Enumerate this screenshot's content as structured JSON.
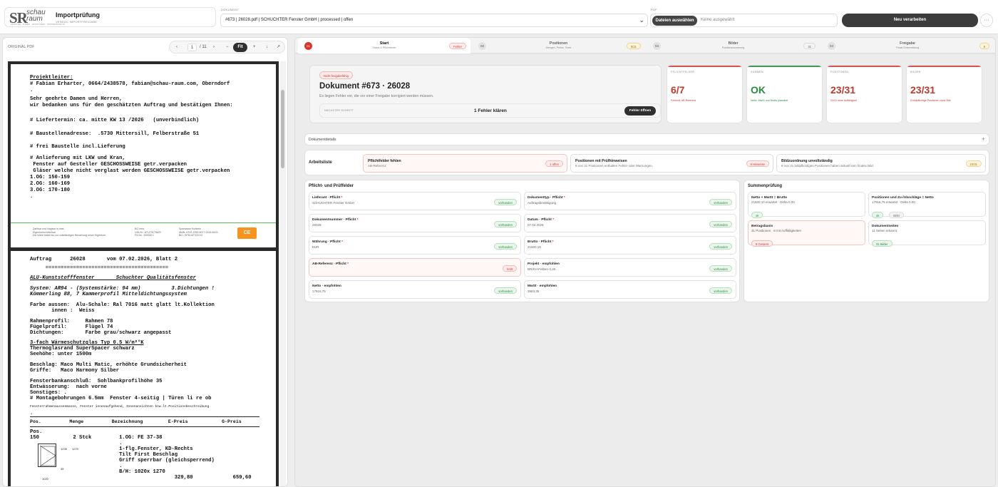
{
  "header": {
    "logo_sr": "SR",
    "logo_schau": "schau",
    "logo_raum": "raum",
    "logo_tag": "FENSTER · TÜREN · HAUSTÜREN · SONNENSCHUTZ",
    "app_title": "Importprüfung",
    "app_subtitle": "VENDOC IMPORTFREIGABE",
    "doc_label": "DOKUMENT",
    "doc_value": "#673 | 26028.pdf | SCHUCHTER Fenster GmbH | processed | offen",
    "pdf_label": "PDF",
    "file_button": "Dateien auswählen",
    "file_none": "Keine ausgewählt",
    "reprocess": "Neu verarbeiten",
    "more": "···"
  },
  "viewer": {
    "title": "ORIGINAL PDF",
    "prev": "‹",
    "page": "1",
    "total": "/ 11",
    "next": "›",
    "zoom_out": "−",
    "fit": "Fit",
    "zoom_in": "+",
    "download": "↓",
    "open": "↗",
    "page1": [
      "Projektleiter:",
      "# Fabian Erharter, 0664/2438578, fabian@schau-raum.com, Oberndorf",
      ".",
      "Sehr geehrte Damen und Herren,",
      "wir bedanken uns für den geschätzten Auftrag und bestätigen Ihnen:",
      "# Liefertermin: ca. mitte KW 13 /2026   (unverbindlich)",
      "# Baustellenadresse:  .5730 Mittersill, Felberstraße 51",
      "# frei Baustelle incl.Lieferung",
      "# Anlieferung mit LKW und Kran,",
      " Fenster auf Gesteller GESCHOSSWEISE getr.verpacken",
      " Gläser welche nicht verglast werden GESCHOSSWEISE getr.verpacken",
      "1.OG: 150-159",
      "2.OG: 160-169",
      "3.OG: 170-180",
      "."
    ],
    "footer1": [
      "Zahlbar und klagbar in Imst",
      "Eigentumsvorbehalt",
      "Die Ware bleibt bis zur vollständigen Bezahlung unser Eigentum."
    ],
    "footer2": [
      "BG Imst",
      "UID-Nr.: ATU79175629",
      "FN-Nr.: 599940 t"
    ],
    "footer3": [
      "Sparkasse Kufstein",
      "IBAN: AT43 2050 6077 0016 8425",
      "BIC: SPKUAT22XXX"
    ],
    "ce": "CE",
    "page2": [
      "Auftrag      26028       vom 07.02.2026, Blatt 2",
      "     ========================================",
      "ALU-Kunststofffenster       Schuchter Qualitätsfenster",
      "System: AR94 - (Systemstärke: 94 mm)          3.Dichtungen !",
      "Kömmerling 88, 7 Kammerprofil Mitteldichtungssystem",
      "Farbe aussen:  Alu-Schale: Ral 7016 matt glatt lt.Kollektion",
      "       innen :  Weiss",
      "Rahmenprofil:     Rahmen 78",
      "Fügelprofil:      Flügel 74",
      "Dichtungen:       Farbe grau/schwarz angepasst",
      "3-fach Wärmeschutzglas Typ 0.5 W/m²°K",
      "Thermoglasrand SuperSpacer schwarz",
      "Seehöhe: unter 1500m",
      "Beschlag: Maco Multi Matic, erhöhte Grundsicherheit",
      "Griffe:   Maco Harmony Silber",
      "Fensterbankanschluß:  Sohlbankprofilhöhe 35",
      "Entwässerung:  nach vorne",
      "Sonstiges: .",
      "# Montagebohrungen 6.5mm  Fenster 4-seitig | Türen li re ob",
      "Fensterrahmenaussenmasse, Fenster innenaufgehend, Innenansichten bzw.lt.Positionsbeschreibung",
      ".",
      "Pos.          Menge          Bezeichnung         E-Preis            G-Preis",
      "Pos.",
      "150           2 Stck         1.OG: FE 37-38",
      "                             .",
      "                             1-flg.Fenster, KD-Rechts",
      "                             Tilt First Beschlag",
      "                             Griff sperrbar (gleichsperrend)",
      "                             .",
      "                             B/H: 1020x 1270",
      "                                               329,80             659,60"
    ],
    "dims": [
      "1235",
      "1270",
      "35",
      "1020"
    ]
  },
  "tabs": [
    {
      "num": "01",
      "name": "Start",
      "sub": "Status & Pflichtfelder",
      "badge": "Fehler",
      "tone": "red"
    },
    {
      "num": "02",
      "name": "Positionen",
      "sub": "Mengen, Preise, Texte",
      "badge": "8/31",
      "tone": "amber"
    },
    {
      "num": "03",
      "name": "Bilder",
      "sub": "Positionszuordnung",
      "badge": "31",
      "tone": "gray"
    },
    {
      "num": "04",
      "name": "Freigabe",
      "sub": "Finale Entscheidung",
      "badge": "8",
      "tone": "amber"
    }
  ],
  "hero": {
    "status": "Nicht freigabefähig",
    "title": "Dokument #673 · 26028",
    "desc": "Es liegen Fehler vor, die vor einer Freigabe korrigiert werden müssen.",
    "next_label": "NÄCHSTER SCHRITT",
    "next_value": "1 Fehler klären",
    "next_button": "Fehler öffnen"
  },
  "stats": [
    {
      "label": "PFLICHTFELDER",
      "value": "6/7",
      "desc": "Fehlend: AB-Referenz",
      "color": "#c0392b"
    },
    {
      "label": "SUMMEN",
      "value": "OK",
      "desc": "Netto, MwSt und Brutto plausibel",
      "color": "#2b8a3e"
    },
    {
      "label": "POSITIONEN",
      "value": "23/31",
      "desc": "23/31 ohne Auffälligkeit",
      "color": "#c0392b"
    },
    {
      "label": "BILDER",
      "value": "23/31",
      "desc": "8 bildpflichtige Positionen ohne Bild",
      "color": "#c0392b"
    }
  ],
  "details": {
    "label": "Dokumentdetails",
    "toggle": "+"
  },
  "worklist": {
    "title": "Arbeitsliste",
    "items": [
      {
        "title": "Pflichtfelder fehlen",
        "sub": "AB-Referenz",
        "badge": "1 offen"
      },
      {
        "title": "Positionen mit Prüfhinweisen",
        "sub": "8 von 31 Positionen enthalten Fehler oder Warnungen.",
        "badge": "8 Hinweise"
      },
      {
        "title": "Bildzuordnung unvollständig",
        "sub": "8 von 31 bildpflichtigen Positionen haben aktuell kein finales Bild.",
        "badge": "23/31"
      }
    ]
  },
  "fields": {
    "title": "Pflicht- und Prüffelder",
    "items": [
      {
        "label": "Lieferant · Pflicht",
        "req": "*",
        "value": "SCHUCHTER Fenster GmbH",
        "status": "vorhanden",
        "tone": "green"
      },
      {
        "label": "Dokumenttyp · Pflicht",
        "req": "*",
        "value": "Auftragsbestätigung",
        "status": "vorhanden",
        "tone": "green"
      },
      {
        "label": "Dokumentnummer · Pflicht",
        "req": "*",
        "value": "26028",
        "status": "vorhanden",
        "tone": "green"
      },
      {
        "label": "Datum · Pflicht",
        "req": "*",
        "value": "07.02.2026",
        "status": "vorhanden",
        "tone": "green"
      },
      {
        "label": "Währung · Pflicht",
        "req": "*",
        "value": "EUR",
        "status": "vorhanden",
        "tone": "green"
      },
      {
        "label": "Brutto · Pflicht",
        "req": "*",
        "value": "21500,10",
        "status": "vorhanden",
        "tone": "green"
      },
      {
        "label": "AB-Referenz · Pflicht",
        "req": "*",
        "value": "",
        "status": "fehlt",
        "tone": "red"
      },
      {
        "label": "Projekt · empfohlen",
        "req": "",
        "value": "BR/KH-Felben-3,4K",
        "status": "vorhanden",
        "tone": "green"
      },
      {
        "label": "Netto · empfohlen",
        "req": "",
        "value": "17916,75",
        "status": "vorhanden",
        "tone": "green"
      },
      {
        "label": "MwSt · empfohlen",
        "req": "",
        "value": "3583,35",
        "status": "vorhanden",
        "tone": "green"
      }
    ]
  },
  "sums": {
    "title": "Summenprüfung",
    "items": [
      {
        "title": "Netto + MwSt = Brutto",
        "value": "21500,10 erwartet · Delta 0,00",
        "chips": [
          {
            "text": "ok",
            "tone": "green"
          }
        ]
      },
      {
        "title": "Positionen und Zu-/Abschläge = Netto",
        "value": "17916,75 erwartet · Delta 0,00",
        "chips": [
          {
            "text": "ok",
            "tone": "green"
          },
          {
            "text": "strikt",
            "tone": "gray"
          }
        ]
      },
      {
        "title": "Betragsbasis",
        "value": "31 Positionen · 8 mit Auffälligkeiten",
        "chips": [
          {
            "text": "8 Gesamt",
            "tone": "red"
          }
        ]
      },
      {
        "title": "Dokumentseiten",
        "value": "11 Seiten erkannt",
        "chips": [
          {
            "text": "31 Bilder",
            "tone": "green"
          }
        ]
      }
    ]
  }
}
